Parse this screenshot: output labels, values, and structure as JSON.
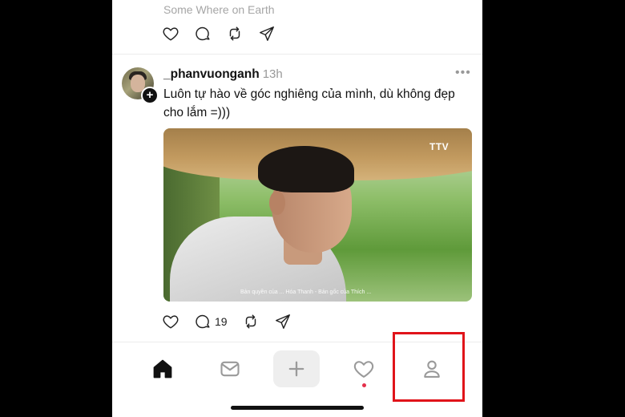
{
  "previous_post": {
    "location": "Some Where on Earth"
  },
  "post": {
    "username": "_phanvuonganh",
    "time": "13h",
    "more_label": "•••",
    "caption": "Luôn tự hào về góc nghiêng của mình, dù không đẹp cho lắm =)))",
    "media": {
      "broadcaster_logo": "TTV",
      "subtitle": "Bản quyền của ... Hóa Thanh - Bản gốc của Thích ..."
    },
    "reply_count": "19",
    "follow_badge": "+"
  },
  "actions": {
    "like_icon": "heart-icon",
    "reply_icon": "comment-icon",
    "repost_icon": "repost-icon",
    "share_icon": "send-icon"
  },
  "tabbar": {
    "items": [
      {
        "name": "home",
        "icon": "home-icon",
        "active": true
      },
      {
        "name": "messages",
        "icon": "mail-icon"
      },
      {
        "name": "create",
        "icon": "plus-icon"
      },
      {
        "name": "activity",
        "icon": "heart-icon",
        "has_notification": true
      },
      {
        "name": "profile",
        "icon": "person-icon",
        "highlighted": true
      }
    ]
  },
  "colors": {
    "highlight": "#e0141a",
    "notification_dot": "#e4304b",
    "secondary_text": "#999999"
  }
}
